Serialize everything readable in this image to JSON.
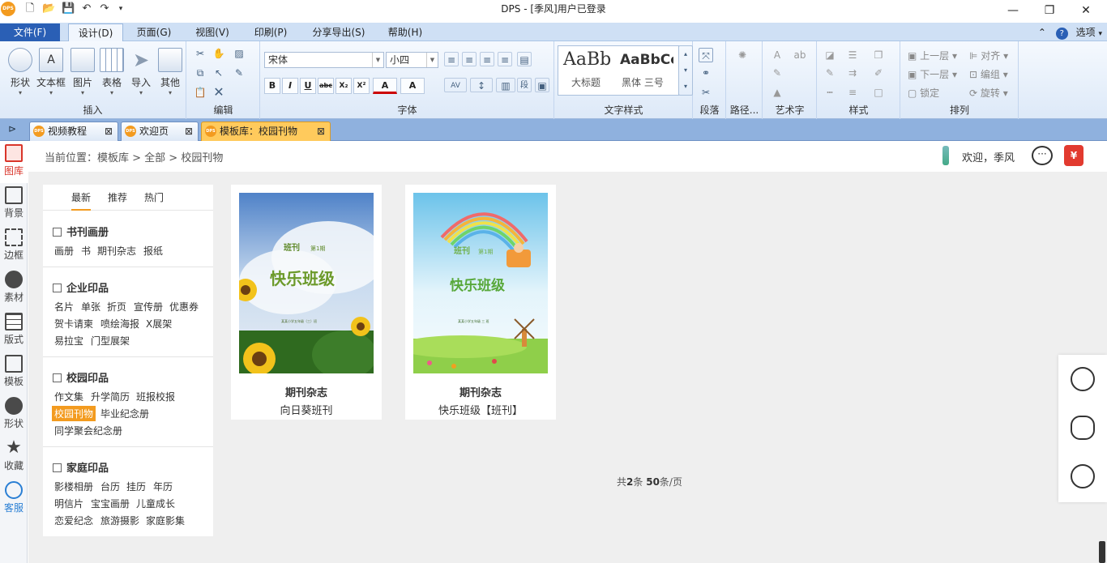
{
  "titlebar": {
    "app_logo": "DPS",
    "title": "DPS - [季风]用户已登录",
    "quick_icons": [
      "new-icon",
      "open-icon",
      "save-icon",
      "undo-icon",
      "redo-icon",
      "customize-icon"
    ],
    "controls": {
      "minimize": "—",
      "restore": "❐",
      "close": "✕"
    }
  },
  "menubar": {
    "file_label": "文件(F)",
    "tabs": [
      "设计(D)",
      "页面(G)",
      "视图(V)",
      "印刷(P)",
      "分享导出(S)",
      "帮助(H)"
    ],
    "active_tab": "设计(D)",
    "options_label": "选项",
    "help_icon": "?"
  },
  "ribbon": {
    "insert": {
      "label": "插入",
      "buttons": [
        "形状",
        "文本框",
        "图片",
        "表格",
        "导入",
        "其他"
      ]
    },
    "edit": {
      "label": "编辑"
    },
    "font": {
      "label": "字体",
      "font_name": "宋体",
      "font_size": "小四",
      "formats": [
        "B",
        "I",
        "U",
        "abc",
        "X₂",
        "X²",
        "A",
        "A"
      ]
    },
    "text_style": {
      "label": "文字样式",
      "style1_sample": "AaBb",
      "style1_name": "大标题",
      "style2_sample": "AaBbCc",
      "style2_name": "黑体 三号"
    },
    "paragraph": {
      "label": "段落"
    },
    "path": {
      "label": "路径..."
    },
    "art_text": {
      "label": "艺术字"
    },
    "style": {
      "label": "样式"
    },
    "arrange": {
      "label": "排列",
      "items": [
        "上一层",
        "对齐",
        "下一层",
        "编组",
        "锁定",
        "旋转"
      ]
    }
  },
  "doc_tabs": [
    {
      "label": "视频教程",
      "active": false
    },
    {
      "label": "欢迎页",
      "active": false
    },
    {
      "label": "模板库：校园刊物",
      "active": true
    }
  ],
  "sidebar": [
    {
      "label": "图库",
      "icon": "gallery-icon",
      "state": "active"
    },
    {
      "label": "背景",
      "icon": "background-icon",
      "state": ""
    },
    {
      "label": "边框",
      "icon": "border-icon",
      "state": ""
    },
    {
      "label": "素材",
      "icon": "material-icon",
      "state": ""
    },
    {
      "label": "版式",
      "icon": "layout-icon",
      "state": ""
    },
    {
      "label": "模板",
      "icon": "template-icon",
      "state": ""
    },
    {
      "label": "形状",
      "icon": "shape-icon",
      "state": ""
    },
    {
      "label": "收藏",
      "icon": "star-icon",
      "state": ""
    },
    {
      "label": "客服",
      "icon": "service-icon",
      "state": "blue"
    }
  ],
  "header": {
    "breadcrumb": "当前位置：模板库 > 全部 > 校园刊物",
    "welcome": "欢迎，季风",
    "gift_symbol": "¥"
  },
  "category_panel": {
    "tabs": [
      "最新",
      "推荐",
      "热门"
    ],
    "active_tab": "最新",
    "sections": [
      {
        "title": "书刊画册",
        "links": [
          "画册",
          "书",
          "期刊杂志",
          "报纸"
        ]
      },
      {
        "title": "企业印品",
        "links": [
          "名片",
          "单张",
          "折页",
          "宣传册",
          "优惠券",
          "贺卡请柬",
          "喷绘海报",
          "X展架",
          "易拉宝",
          "门型展架"
        ]
      },
      {
        "title": "校园印品",
        "links": [
          "作文集",
          "升学简历",
          "班报校报",
          "校园刊物",
          "毕业纪念册",
          "同学聚会纪念册"
        ],
        "active": "校园刊物"
      },
      {
        "title": "家庭印品",
        "links": [
          "影楼相册",
          "台历",
          "挂历",
          "年历",
          "明信片",
          "宝宝画册",
          "儿童成长",
          "恋爱纪念",
          "旅游摄影",
          "家庭影集"
        ]
      }
    ]
  },
  "templates": [
    {
      "category": "期刊杂志",
      "title": "向日葵班刊",
      "cover_label": "班刊",
      "cover_issue": "第1期",
      "cover_heading": "快乐班级",
      "cover_small": "某某小学五年级（三）班"
    },
    {
      "category": "期刊杂志",
      "title": "快乐班级【班刊】",
      "cover_label": "班刊",
      "cover_issue": "第1期",
      "cover_heading": "快乐班级",
      "cover_small": "某某小学五年级  三  班"
    }
  ],
  "pager": {
    "prefix": "共",
    "count": "2",
    "unit": "条",
    "per_page": "50",
    "suffix": "条/页"
  },
  "float_bar": [
    "qq-icon",
    "wechat-icon",
    "headset-icon"
  ]
}
